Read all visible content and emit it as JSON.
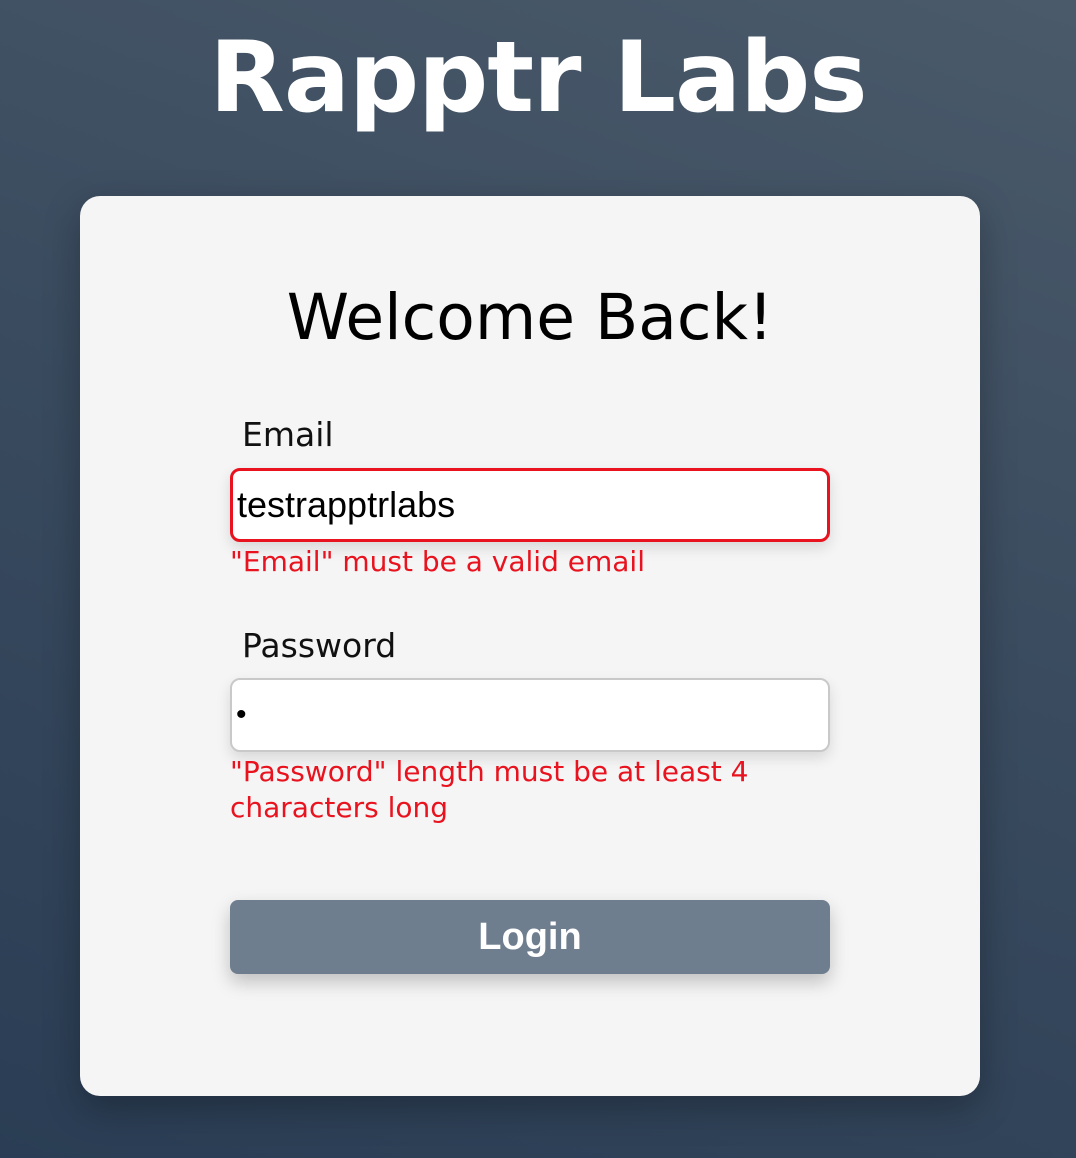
{
  "brand": {
    "title": "Rapptr Labs"
  },
  "login_form": {
    "heading": "Welcome Back!",
    "email": {
      "label": "Email",
      "value": "testrapptrlabs",
      "error": "\"Email\" must be a valid email"
    },
    "password": {
      "label": "Password",
      "value": "•",
      "error": "\"Password\" length must be at least 4 characters long"
    },
    "submit_label": "Login"
  },
  "colors": {
    "error": "#e8131e",
    "button_background": "#6f7e8f",
    "card_background": "#f5f5f5",
    "page_background": "#34465a"
  }
}
